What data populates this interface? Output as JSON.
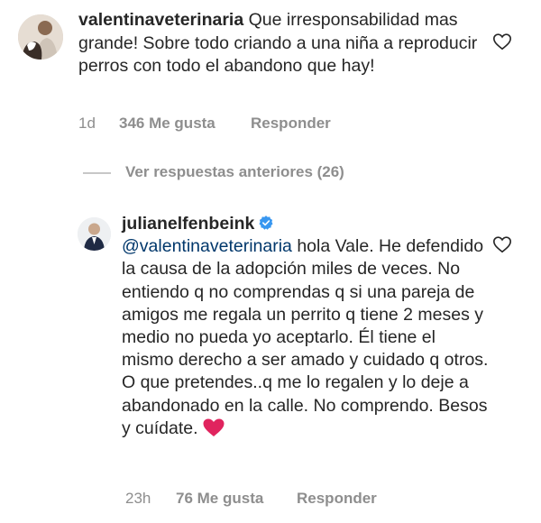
{
  "comment1": {
    "username": "valentinaveterinaria",
    "text": "Que irresponsabilidad mas grande! Sobre todo criando a una niña a reproducir perros con todo el abandono que hay!",
    "time": "1d",
    "likes": "346 Me gusta",
    "reply_label": "Responder",
    "like_icon": "heart-outline-icon"
  },
  "view_replies": {
    "label": "Ver respuestas anteriores (26)"
  },
  "comment2": {
    "username": "julianelfenbeink",
    "verified_icon": "verified-badge-icon",
    "mention": "@valentinaveterinaria",
    "text": " hola Vale. He defendido la causa de la adopción miles de veces. No entiendo q no comprendas q si una pareja de amigos me regala un perrito q tiene 2 meses y medio no pueda yo aceptarlo. Él tiene el mismo derecho a ser amado y cuidado q otros. O que pretendes..q me lo regalen y lo deje a abandonado en la calle. No comprendo. Besos y cuídate.",
    "emoji": "red-heart-emoji",
    "time": "23h",
    "likes": "76 Me gusta",
    "reply_label": "Responder",
    "like_icon": "heart-outline-icon"
  },
  "colors": {
    "text": "#262626",
    "secondary": "#8e8e8e",
    "mention": "#00376b",
    "verified": "#3897f0",
    "heart_emoji": "#e0245e"
  }
}
